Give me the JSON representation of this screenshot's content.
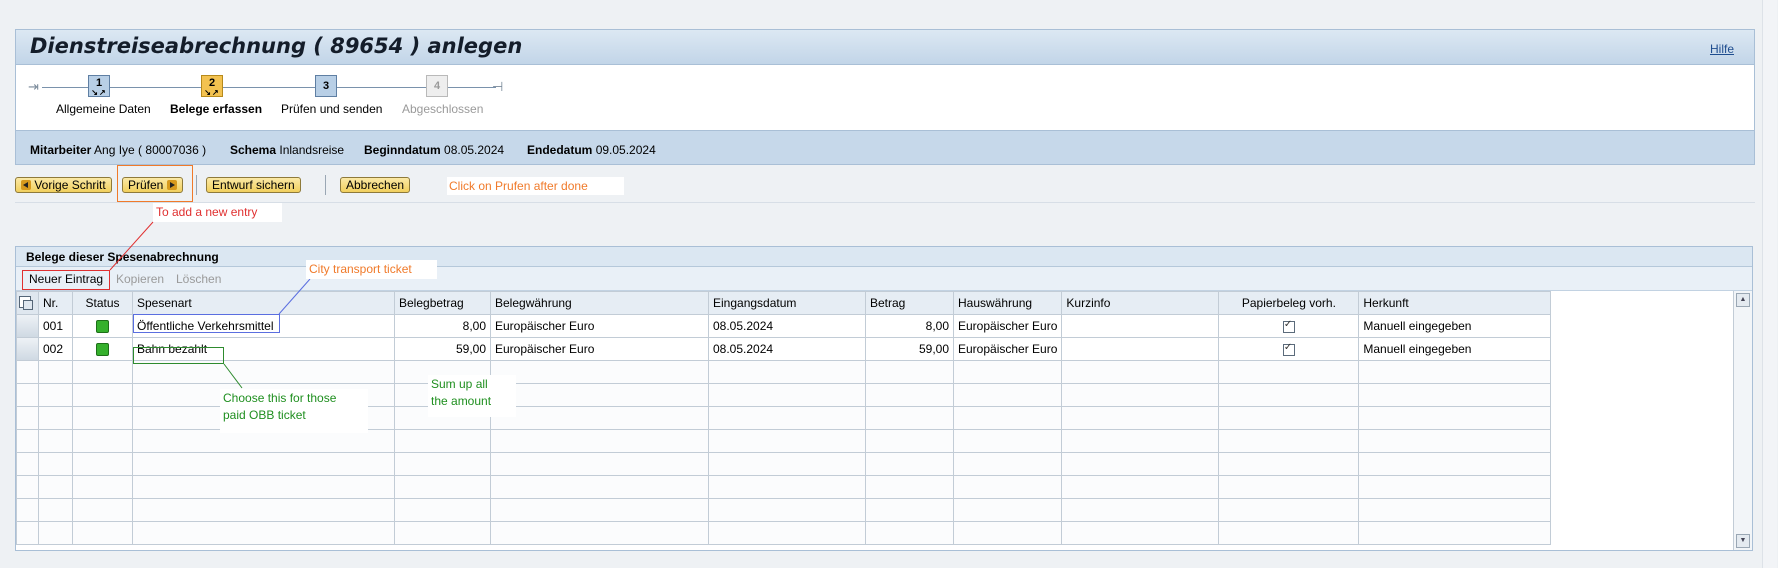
{
  "title": "Dienstreiseabrechnung ( 89654 ) anlegen",
  "help_link": "Hilfe",
  "roadmap": {
    "steps": [
      {
        "num": "1",
        "label": "Allgemeine Daten"
      },
      {
        "num": "2",
        "label": "Belege erfassen"
      },
      {
        "num": "3",
        "label": "Prüfen und senden"
      },
      {
        "num": "4",
        "label": "Abgeschlossen"
      }
    ]
  },
  "header_info": {
    "employee_label": "Mitarbeiter",
    "employee_value": "Ang Iye ( 80007036 )",
    "schema_label": "Schema",
    "schema_value": "Inlandsreise",
    "start_label": "Beginndatum",
    "start_value": "08.05.2024",
    "end_label": "Endedatum",
    "end_value": "09.05.2024"
  },
  "toolbar": {
    "prev": "Vorige Schritt",
    "check": "Prüfen",
    "save_draft": "Entwurf sichern",
    "cancel": "Abbrechen"
  },
  "annotations": {
    "click_check": "Click on Prufen after done",
    "add_entry": "To add a new entry",
    "city_ticket": "City transport ticket",
    "choose_line1": "Choose this for those",
    "choose_line2": "paid OBB ticket",
    "sum_line1": "Sum up all",
    "sum_line2": "the amount"
  },
  "panel": {
    "title": "Belege dieser Spesenabrechnung",
    "new_entry": "Neuer Eintrag",
    "copy": "Kopieren",
    "delete": "Löschen"
  },
  "table": {
    "columns": [
      "Nr.",
      "Status",
      "Spesenart",
      "Belegbetrag",
      "Belegwährung",
      "Eingangsdatum",
      "Betrag",
      "Hauswährung",
      "Kurzinfo",
      "Papierbeleg vorh.",
      "Herkunft"
    ],
    "rows": [
      {
        "nr": "001",
        "spesenart": "Öffentliche Verkehrsmittel",
        "belegbetrag": "8,00",
        "belegwaehrung": "Europäischer Euro",
        "eingangsdatum": "08.05.2024",
        "betrag": "8,00",
        "hauswaehrung": "Europäischer Euro",
        "kurzinfo": "",
        "herkunft": "Manuell eingegeben"
      },
      {
        "nr": "002",
        "spesenart": "Bahn bezahlt",
        "belegbetrag": "59,00",
        "belegwaehrung": "Europäischer Euro",
        "eingangsdatum": "08.05.2024",
        "betrag": "59,00",
        "hauswaehrung": "Europäischer Euro",
        "kurzinfo": "",
        "herkunft": "Manuell eingegeben"
      }
    ]
  },
  "colors": {
    "accent_orange": "#f07a2a",
    "annotation_red": "#e03030",
    "annotation_green": "#1f8f1f",
    "annotation_blue": "#5a6ee0",
    "status_green": "#35b02c",
    "button_yellow": "#f1cf5d"
  }
}
